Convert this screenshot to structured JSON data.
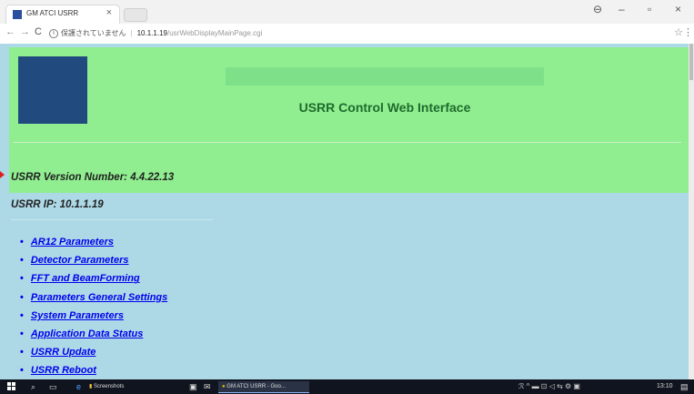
{
  "browser": {
    "tab_title": "GM ATCI USRR",
    "tab_close": "×",
    "window_controls": [
      "⊖",
      "–",
      "▫",
      "×"
    ],
    "nav_buttons": [
      "←",
      "→",
      "C"
    ],
    "security_label": "保護されていません",
    "url_host": "10.1.1.19",
    "url_path": "/usrWebDisplayMainPage.cgi",
    "star": "☆",
    "menu": "⋮"
  },
  "page": {
    "header_title": "USRR Control Web Interface",
    "version": "USRR Version Number: 4.4.22.13",
    "ip": "USRR IP: 10.1.1.19",
    "links": [
      "AR12 Parameters",
      "Detector Parameters",
      "FFT and BeamForming",
      "Parameters General Settings",
      "System Parameters",
      "Application Data Status",
      "USRR Update",
      "USRR Reboot"
    ],
    "colors": {
      "header_bg": "#90ee90",
      "page_bg": "#add8e6",
      "logo": "#214a7f",
      "link": "#0000ee"
    }
  },
  "taskbar": {
    "search_icon": "⌕",
    "folder_label": "Screenshots",
    "active_task": "GM ATCI USRR - Goo...",
    "tray_icons": "ℛ  ^  ▬  ⊡  ◁  ⇆  ⚙  ▣",
    "clock": "13:10"
  }
}
